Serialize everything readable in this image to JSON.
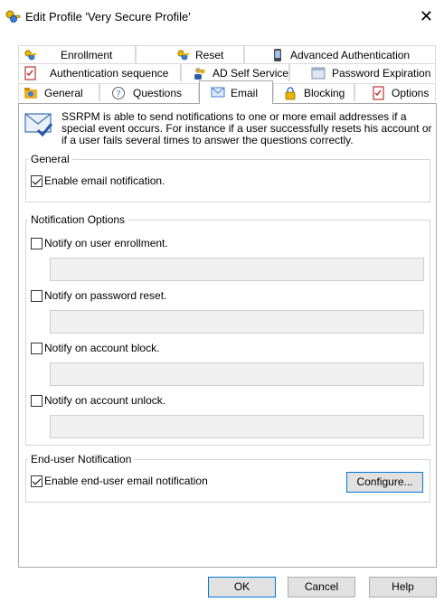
{
  "window": {
    "title": "Edit Profile 'Very Secure Profile'",
    "close_glyph": "✕"
  },
  "tabs": {
    "row1": [
      {
        "label": "Enrollment",
        "icon": "keys-icon"
      },
      {
        "label": "Reset",
        "icon": "keys-icon"
      },
      {
        "label": "Advanced Authentication",
        "icon": "phone-icon"
      }
    ],
    "row2": [
      {
        "label": "Authentication sequence",
        "icon": "checklist-icon"
      },
      {
        "label": "AD Self Service",
        "icon": "users-icon"
      },
      {
        "label": "Password Expiration",
        "icon": "calendar-icon"
      }
    ],
    "row3": [
      {
        "label": "General",
        "icon": "folder-icon"
      },
      {
        "label": "Questions",
        "icon": "question-icon"
      },
      {
        "label": "Email",
        "icon": "email-icon"
      },
      {
        "label": "Blocking",
        "icon": "lock-icon"
      },
      {
        "label": "Options",
        "icon": "checklist-icon"
      }
    ],
    "active": "Email"
  },
  "intro": {
    "text": "SSRPM is able to send notifications to one or more email addresses if a special event occurs. For instance if a user successfully resets his account or if a user fails several times to answer the questions correctly."
  },
  "general": {
    "title": "General",
    "enable_email": {
      "label": "Enable email notification.",
      "checked": true
    }
  },
  "notification_options": {
    "title": "Notification Options",
    "items": [
      {
        "label": "Notify on user enrollment.",
        "checked": false,
        "value": ""
      },
      {
        "label": "Notify on password reset.",
        "checked": false,
        "value": ""
      },
      {
        "label": "Notify on account block.",
        "checked": false,
        "value": ""
      },
      {
        "label": "Notify on account unlock.",
        "checked": false,
        "value": ""
      }
    ]
  },
  "end_user": {
    "title": "End-user Notification",
    "enable": {
      "label": "Enable end-user email notification",
      "checked": true
    },
    "configure_label": "Configure..."
  },
  "buttons": {
    "ok": "OK",
    "cancel": "Cancel",
    "help": "Help"
  }
}
